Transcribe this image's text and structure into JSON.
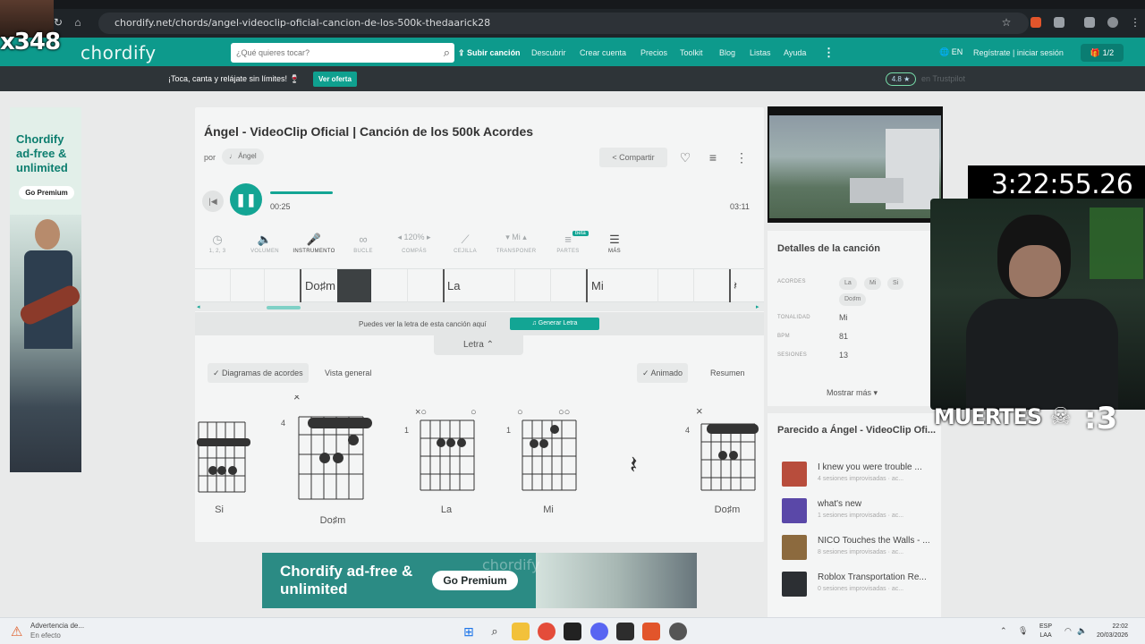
{
  "browser": {
    "url": "chordify.net/chords/angel-videoclip-oficial-cancion-de-los-500k-thedaarick28"
  },
  "header": {
    "logo": "chordify",
    "search_placeholder": "¿Qué quieres tocar?",
    "upload_label": "Subir canción",
    "nav": [
      "Descubrir",
      "Crear cuenta",
      "Precios",
      "Toolkit",
      "Blog",
      "Listas",
      "Ayuda"
    ],
    "lang": "EN",
    "login": "Regístrate | iniciar sesión",
    "badge": "1/2"
  },
  "promo": {
    "text": "¡Toca, canta y relájate sin límites! 🍷",
    "button": "Ver oferta",
    "rating": "4.8 ★",
    "trustpilot": "en Trustpilot"
  },
  "left_ad": {
    "title": "Chordify ad-free & unlimited",
    "button": "Go Premium"
  },
  "song": {
    "title": "Ángel - VideoClip Oficial | Canción de los 500k Acordes",
    "por": "por",
    "artist": "♩ Ángel",
    "share": "Compartir",
    "time_current": "00:25",
    "time_total": "03:11",
    "progress": 0.13
  },
  "toolbar": [
    {
      "label": "1, 2, 3",
      "icon": "◷"
    },
    {
      "label": "VOLUMEN",
      "icon": "🔈"
    },
    {
      "label": "INSTRUMENTO",
      "icon": "🎤"
    },
    {
      "label": "BUCLE",
      "icon": "∞"
    },
    {
      "label": "COMPÁS",
      "icon": "◂ 120% ▸"
    },
    {
      "label": "CEJILLA",
      "icon": "⟋"
    },
    {
      "label": "TRANSPONER",
      "icon": "▾ Mi ▴"
    },
    {
      "label": "PARTES",
      "icon": "≡"
    },
    {
      "label": "MÁS",
      "icon": "☰"
    }
  ],
  "toolbar_beta": "beta",
  "strip_chords": [
    "Do♯m",
    "La",
    "Mi",
    "𝄽"
  ],
  "lyrics": {
    "note": "Puedes ver la letra de esta canción aquí",
    "button": "Generar Letra",
    "tab": "Letra"
  },
  "view_controls": {
    "diagrams": "✓  Diagramas de acordes",
    "overview": "Vista general",
    "animated": "✓  Animado",
    "summary": "Resumen"
  },
  "diagrams": [
    {
      "name": "Si",
      "fret": "",
      "fingers": "2 3 4"
    },
    {
      "name": "Do♯m",
      "fret": "4",
      "fingers": "1 2 3 4"
    },
    {
      "name": "La",
      "fret": "1",
      "fingers": "2 3 4"
    },
    {
      "name": "Mi",
      "fret": "1",
      "fingers": "1 2 3"
    },
    {
      "name": "Do♯m",
      "fret": "4",
      "fingers": "1 3 4"
    }
  ],
  "details": {
    "title": "Detalles de la canción",
    "labels": {
      "chords": "ACORDES",
      "key": "TONALIDAD",
      "bpm": "BPM",
      "sessions": "SESIONES"
    },
    "chords": [
      "La",
      "Mi",
      "Si",
      "Do♯m"
    ],
    "key": "Mi",
    "bpm": "81",
    "sessions": "13",
    "more": "Mostrar más ▾"
  },
  "similar": {
    "title": "Parecido a Ángel - VideoClip Ofi...",
    "items": [
      {
        "title": "I knew you were trouble ...",
        "sub": "4 sesiones improvisadas · ac...",
        "color": "#b84d3c"
      },
      {
        "title": "what's new",
        "sub": "1 sesiones improvisadas · ac...",
        "color": "#5a48a8"
      },
      {
        "title": "NICO Touches the Walls - ...",
        "sub": "8 sesiones improvisadas · ac...",
        "color": "#8c6a3e"
      },
      {
        "title": "Roblox Transportation Re...",
        "sub": "0 sesiones improvisadas · ac...",
        "color": "#2c2f33"
      }
    ]
  },
  "bottom_banner": {
    "text": "Chordify ad-free & unlimited",
    "button": "Go Premium",
    "logo": "chordify"
  },
  "overlay": {
    "count": "x348",
    "timer": "3:22:55.26",
    "muertes_label": "MUERTES",
    "muertes_count": ":3"
  },
  "taskbar": {
    "warning_title": "Advertencia de...",
    "warning_sub": "En efecto",
    "lang_line1": "ESP",
    "lang_line2": "LAA",
    "time": "22:02",
    "date": "20/03/2026"
  },
  "colors": {
    "brand": "#0d9a8c",
    "accent": "#13a594",
    "promo_bg": "#2e3438"
  }
}
